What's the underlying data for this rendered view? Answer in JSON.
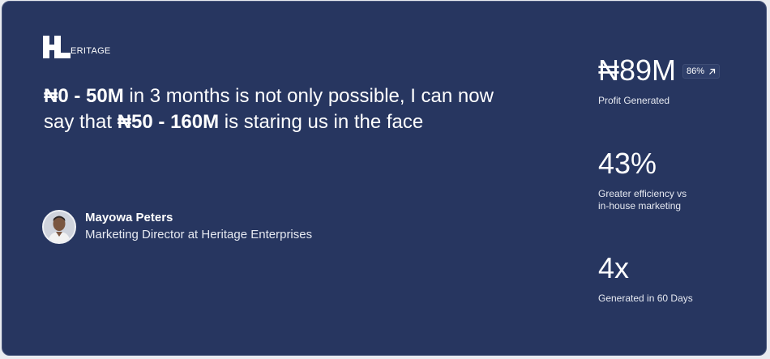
{
  "brand": {
    "logo_text": "ERITAGE"
  },
  "quote": {
    "part1_bold": "₦0 - 50M",
    "part2": " in 3 months is not only possible, I can now say that ",
    "part3_bold": "₦50 - 160M",
    "part4": " is staring us in the face"
  },
  "author": {
    "name": "Mayowa Peters",
    "title": "Marketing Director at Heritage Enterprises"
  },
  "stats": [
    {
      "value": "₦89M",
      "badge": "86%",
      "badge_icon": "arrow-up-right-icon",
      "label": "Profit Generated"
    },
    {
      "value": "43%",
      "label": "Greater efficiency vs\nin-house marketing"
    },
    {
      "value": "4x",
      "label": "Generated in 60 Days"
    }
  ],
  "colors": {
    "card_background": "#273660",
    "card_border": "#4a587e",
    "text": "#ffffff"
  }
}
